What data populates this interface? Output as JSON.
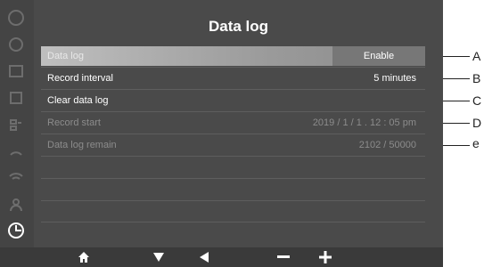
{
  "screen": {
    "title": "Data log"
  },
  "rows": [
    {
      "label": "Data log",
      "value": "Enable"
    },
    {
      "label": "Record interval",
      "value": "5 minutes"
    },
    {
      "label": "Clear data log",
      "value": ""
    },
    {
      "label": "Record start",
      "value": "2019 / 1 / 1 . 12 : 05 pm"
    },
    {
      "label": "Data log remain",
      "value": "2102 / 50000"
    }
  ],
  "callouts": [
    "A",
    "B",
    "C",
    "D",
    "e"
  ],
  "icons": [
    "home-icon",
    "down-arrow-icon",
    "left-arrow-icon",
    "minus-icon",
    "plus-icon"
  ]
}
